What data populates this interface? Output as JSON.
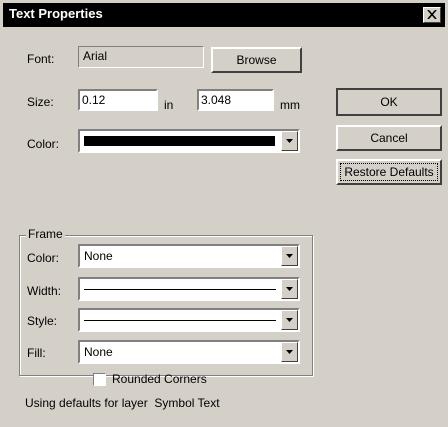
{
  "window": {
    "title": "Text Properties"
  },
  "font": {
    "label": "Font:",
    "value": "Arial",
    "browse_label": "Browse"
  },
  "size": {
    "label": "Size:",
    "inches_value": "0.12",
    "inches_unit": "in",
    "mm_value": "3.048",
    "mm_unit": "mm"
  },
  "color": {
    "label": "Color:",
    "swatch": "#000000"
  },
  "buttons": {
    "ok": "OK",
    "cancel": "Cancel",
    "restore_defaults": "Restore Defaults"
  },
  "frame": {
    "label": "Frame",
    "color": {
      "label": "Color:",
      "value": "None"
    },
    "width": {
      "label": "Width:"
    },
    "style": {
      "label": "Style:"
    },
    "fill": {
      "label": "Fill:",
      "value": "None"
    },
    "rounded_corners": {
      "label": "Rounded Corners",
      "checked": false
    }
  },
  "status": {
    "prefix": "Using defaults for layer",
    "layer": "Symbol Text"
  }
}
